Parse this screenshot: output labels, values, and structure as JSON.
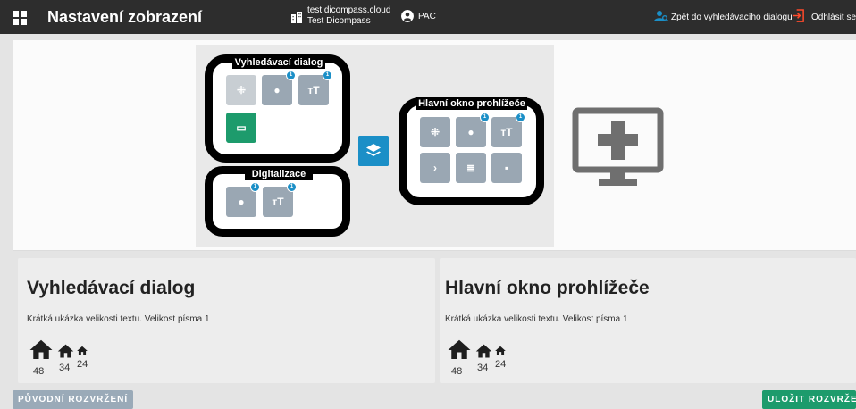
{
  "header": {
    "title": "Nastavení zobrazení",
    "tenant_url": "test.dicompass.cloud",
    "tenant_name": "Test Dicompass",
    "user": "PAC",
    "back_label": "Zpět do vyhledávacího dialogu",
    "logout_label": "Odhlásit se"
  },
  "layout_preview": {
    "panels": [
      {
        "title": "Vyhledávací dialog",
        "tiles": [
          {
            "icon": "resize-icon",
            "badge": ""
          },
          {
            "icon": "palette-icon",
            "badge": "1"
          },
          {
            "icon": "text-size-icon",
            "badge": "1"
          },
          {
            "icon": "laptop-icon",
            "badge": ""
          }
        ]
      },
      {
        "title": "Digitalizace",
        "tiles": [
          {
            "icon": "palette-icon",
            "badge": "1"
          },
          {
            "icon": "text-size-icon",
            "badge": "1"
          }
        ]
      },
      {
        "title": "Hlavní okno prohlížeče",
        "tiles": [
          {
            "icon": "resize-icon",
            "badge": ""
          },
          {
            "icon": "palette-icon",
            "badge": "1"
          },
          {
            "icon": "text-size-icon",
            "badge": "1"
          },
          {
            "icon": "chevron-right-icon",
            "badge": ""
          },
          {
            "icon": "list-icon",
            "badge": ""
          },
          {
            "icon": "square-icon",
            "badge": ""
          }
        ]
      }
    ],
    "stack_icon": "layers-icon",
    "add_icon": "add-monitor-icon"
  },
  "cards": [
    {
      "title": "Vyhledávací dialog",
      "sample": "Krátká ukázka velikosti textu. Velikost písma 1",
      "sizes": [
        "48",
        "34",
        "24"
      ]
    },
    {
      "title": "Hlavní okno prohlížeče",
      "sample": "Krátká ukázka velikosti textu. Velikost písma 1",
      "sizes": [
        "48",
        "34",
        "24"
      ]
    }
  ],
  "buttons": {
    "reset": "PŮVODNÍ ROZVRŽENÍ",
    "save": "ULOŽIT ROZVRŽENÍ"
  },
  "colors": {
    "header_bg": "#2d2d2d",
    "accent_blue": "#1b8fc7",
    "accent_green": "#1d9b6c",
    "tile_grey": "#9aa7b3",
    "logout_red": "#ff4a2b"
  }
}
